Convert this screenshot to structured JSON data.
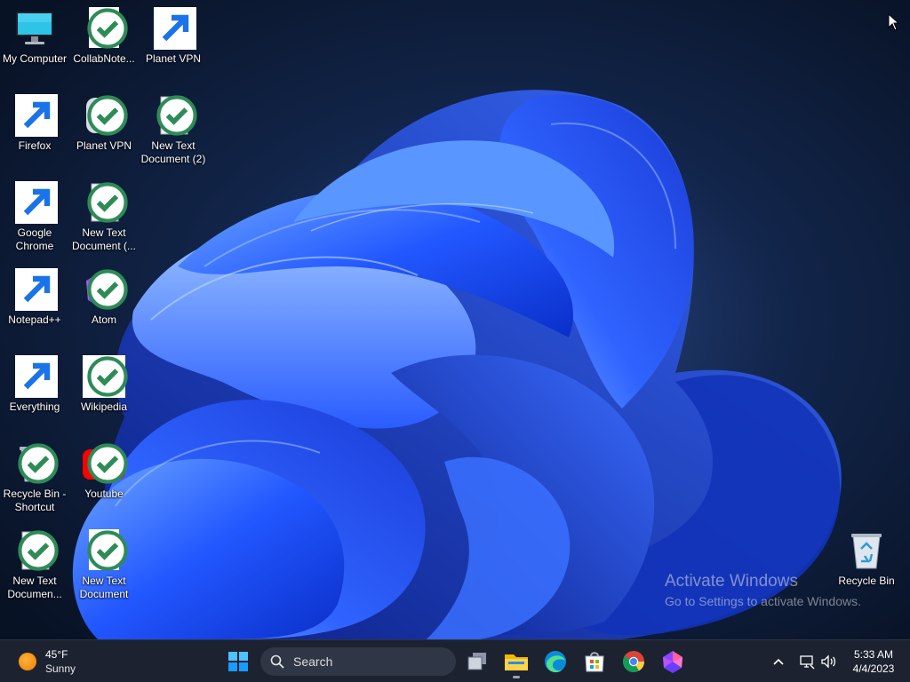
{
  "desktop": {
    "icons": [
      {
        "label": "My Computer"
      },
      {
        "label": "CollabNote..."
      },
      {
        "label": "Planet VPN"
      },
      {
        "label": "Firefox"
      },
      {
        "label": "Planet VPN"
      },
      {
        "label": "New Text Document (2)"
      },
      {
        "label": "Google Chrome"
      },
      {
        "label": "New Text Document (..."
      },
      {
        "label": "Notepad++"
      },
      {
        "label": "Atom"
      },
      {
        "label": "Everything"
      },
      {
        "label": "Wikipedia"
      },
      {
        "label": "Recycle Bin - Shortcut"
      },
      {
        "label": "Youtube"
      },
      {
        "label": "New Text Documen..."
      },
      {
        "label": "New Text Document"
      },
      {
        "label": "Recycle Bin"
      }
    ],
    "watermark": {
      "title": "Activate Windows",
      "subtitle": "Go to Settings to activate Windows."
    }
  },
  "taskbar": {
    "weather": {
      "temperature": "45°F",
      "condition": "Sunny"
    },
    "search": {
      "label": "Search"
    },
    "apps": [
      {
        "name": "start-button"
      },
      {
        "name": "task-view-button"
      },
      {
        "name": "file-explorer-button"
      },
      {
        "name": "edge-button"
      },
      {
        "name": "store-button"
      },
      {
        "name": "chrome-button"
      },
      {
        "name": "atom-button"
      }
    ],
    "clock": {
      "time": "5:33 AM",
      "date": "4/4/2023"
    }
  },
  "colors": {
    "accent": "#1f5cff",
    "taskbar": "#1d2230",
    "desktop_bg": "#0a1428"
  }
}
